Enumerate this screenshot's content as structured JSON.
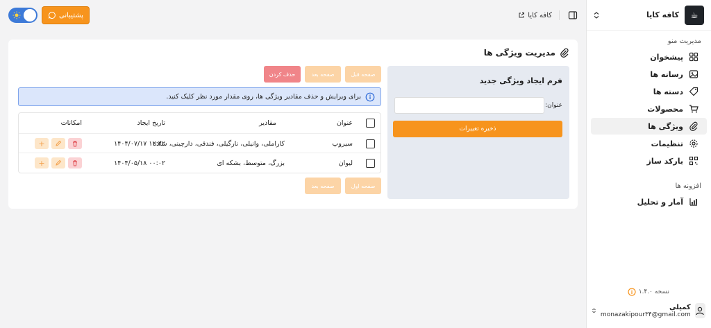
{
  "sidebar": {
    "brand_name": "کافه کایا",
    "menu_section_title": "مدیریت منو",
    "menu_items": [
      {
        "label": "پیشخوان"
      },
      {
        "label": "رسانه ها"
      },
      {
        "label": "دسته ها"
      },
      {
        "label": "محصولات"
      },
      {
        "label": "ویژگی ها"
      },
      {
        "label": "تنظیمات"
      },
      {
        "label": "بارکد ساز"
      }
    ],
    "addons_section_title": "افزونه ها",
    "addon_items": [
      {
        "label": "آمار و تحلیل"
      }
    ],
    "version": "نسخه ۱.۴.۰",
    "user": {
      "name": "کمیلی",
      "email": "monazakipour۳۴@gmail.com"
    }
  },
  "topbar": {
    "breadcrumb": "کافه کایا",
    "support_label": "پشتیبانی"
  },
  "page": {
    "title": "مدیریت ویژگی ها",
    "form": {
      "title": "فرم ایجاد ویژگی جدید",
      "label_title": "عنوان:",
      "input_value": "",
      "save_label": "ذخیره تغییرات"
    },
    "buttons": {
      "prev_page": "صفحه قبل",
      "next_page": "صفحه بعد",
      "delete": "حذف کردن",
      "first_page": "صفحه اول",
      "next_page_bottom": "صفحه بعد"
    },
    "info_text": "برای ویرایش و حذف مقادیر ویژگی ها، روی مقدار مورد نظر کلیک کنید.",
    "table": {
      "headers": {
        "title": "عنوان",
        "values": "مقادیر",
        "date": "تاریخ ایجاد",
        "actions": "امکانات"
      },
      "rows": [
        {
          "title": "سیروپ",
          "values": "کاراملی، وانیلی، نارگیلی، فندقی، دارچینی، ساده",
          "date": "۱۴۰۴/۰۷/۱۷ ۱۲:۲۲"
        },
        {
          "title": "لیوان",
          "values": "بزرگ، متوسط، بشکه ای",
          "date": "۱۴۰۴/۰۵/۱۸ ۰۰:۰۲"
        }
      ]
    }
  },
  "colors": {
    "accent": "#f7941d",
    "info_bg": "#dbe6fb",
    "delete": "#f08589"
  }
}
